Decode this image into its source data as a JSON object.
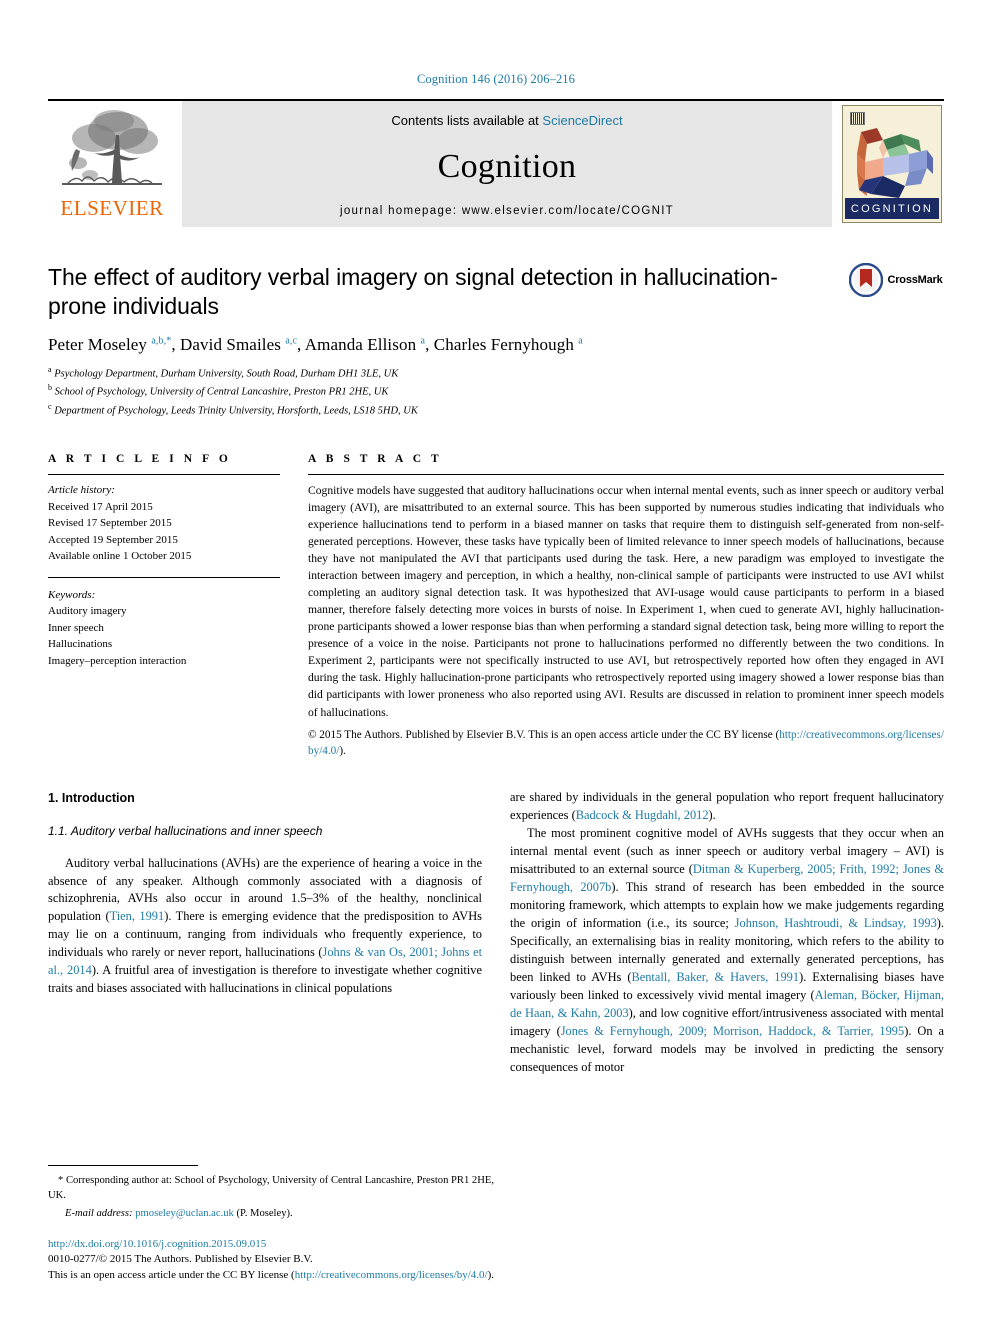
{
  "running_head": "Cognition 146 (2016) 206–216",
  "masthead": {
    "publisher_name": "ELSEVIER",
    "publisher_logo_icon": "elsevier-tree-icon",
    "contents_prefix": "Contents lists available at ",
    "contents_link": "ScienceDirect",
    "journal_name": "Cognition",
    "homepage_label": "journal homepage: www.elsevier.com/locate/COGNIT",
    "cover_title": "COGNITION",
    "cover_icon": "journal-cover-thumbnail"
  },
  "article": {
    "title": "The effect of auditory verbal imagery on signal detection in hallucination-prone individuals",
    "authors_html": "Peter Moseley <sup>a,b,</sup><sup>*</sup>, David Smailes <sup>a,c</sup>, Amanda Ellison <sup>a</sup>, Charles Fernyhough <sup>a</sup>",
    "affiliations": [
      {
        "marker": "a",
        "text": "Psychology Department, Durham University, South Road, Durham DH1 3LE, UK"
      },
      {
        "marker": "b",
        "text": "School of Psychology, University of Central Lancashire, Preston PR1 2HE, UK"
      },
      {
        "marker": "c",
        "text": "Department of Psychology, Leeds Trinity University, Horsforth, Leeds, LS18 5HD, UK"
      }
    ],
    "crossmark_label": "CrossMark",
    "crossmark_icon": "crossmark-badge-icon"
  },
  "article_info": {
    "heading": "A R T I C L E    I N F O",
    "history_label": "Article history:",
    "history": [
      "Received 17 April 2015",
      "Revised 17 September 2015",
      "Accepted 19 September 2015",
      "Available online 1 October 2015"
    ],
    "keywords_label": "Keywords:",
    "keywords": [
      "Auditory imagery",
      "Inner speech",
      "Hallucinations",
      "Imagery–perception interaction"
    ]
  },
  "abstract": {
    "heading": "A B S T R A C T",
    "text": "Cognitive models have suggested that auditory hallucinations occur when internal mental events, such as inner speech or auditory verbal imagery (AVI), are misattributed to an external source. This has been supported by numerous studies indicating that individuals who experience hallucinations tend to perform in a biased manner on tasks that require them to distinguish self-generated from non-self-generated perceptions. However, these tasks have typically been of limited relevance to inner speech models of hallucinations, because they have not manipulated the AVI that participants used during the task. Here, a new paradigm was employed to investigate the interaction between imagery and perception, in which a healthy, non-clinical sample of participants were instructed to use AVI whilst completing an auditory signal detection task. It was hypothesized that AVI-usage would cause participants to perform in a biased manner, therefore falsely detecting more voices in bursts of noise. In Experiment 1, when cued to generate AVI, highly hallucination-prone participants showed a lower response bias than when performing a standard signal detection task, being more willing to report the presence of a voice in the noise. Participants not prone to hallucinations performed no differently between the two conditions. In Experiment 2, participants were not specifically instructed to use AVI, but retrospectively reported how often they engaged in AVI during the task. Highly hallucination-prone participants who retrospectively reported using imagery showed a lower response bias than did participants with lower proneness who also reported using AVI. Results are discussed in relation to prominent inner speech models of hallucinations.",
    "copyright_prefix": "© 2015 The Authors. Published by Elsevier B.V. This is an open access article under the CC BY license (",
    "copyright_link_part1": "http://",
    "copyright_link_part2": "creativecommons.org/licenses/by/4.0/",
    "copyright_suffix": ")."
  },
  "body": {
    "section_number_title": "1. Introduction",
    "subsection_title": "1.1. Auditory verbal hallucinations and inner speech",
    "left_paragraphs": [
      {
        "segments": [
          {
            "t": "Auditory verbal hallucinations (AVHs) are the experience of hearing a voice in the absence of any speaker. Although commonly associated with a diagnosis of schizophrenia, AVHs also occur in around 1.5–3% of the healthy, nonclinical population (",
            "cite": false
          },
          {
            "t": "Tien, 1991",
            "cite": true
          },
          {
            "t": "). There is emerging evidence that the predisposition to AVHs may lie on a continuum, ranging from individuals who frequently experience, to individuals who rarely or never report, hallucinations (",
            "cite": false
          },
          {
            "t": "Johns & van Os, 2001; Johns et al., 2014",
            "cite": true
          },
          {
            "t": "). A fruitful area of investigation is therefore to investigate whether cognitive traits and biases associated with hallucinations in clinical populations",
            "cite": false
          }
        ]
      }
    ],
    "right_paragraphs": [
      {
        "indent": false,
        "segments": [
          {
            "t": "are shared by individuals in the general population who report frequent hallucinatory experiences (",
            "cite": false
          },
          {
            "t": "Badcock & Hugdahl, 2012",
            "cite": true
          },
          {
            "t": ").",
            "cite": false
          }
        ]
      },
      {
        "indent": true,
        "segments": [
          {
            "t": "The most prominent cognitive model of AVHs suggests that they occur when an internal mental event (such as inner speech or auditory verbal imagery – AVI) is misattributed to an external source (",
            "cite": false
          },
          {
            "t": "Ditman & Kuperberg, 2005; Frith, 1992; Jones & Fernyhough, 2007b",
            "cite": true
          },
          {
            "t": "). This strand of research has been embedded in the source monitoring framework, which attempts to explain how we make judgements regarding the origin of information (i.e., its source; ",
            "cite": false
          },
          {
            "t": "Johnson, Hashtroudi, & Lindsay, 1993",
            "cite": true
          },
          {
            "t": "). Specifically, an externalising bias in reality monitoring, which refers to the ability to distinguish between internally generated and externally generated perceptions, has been linked to AVHs (",
            "cite": false
          },
          {
            "t": "Bentall, Baker, & Havers, 1991",
            "cite": true
          },
          {
            "t": "). Externalising biases have variously been linked to excessively vivid mental imagery (",
            "cite": false
          },
          {
            "t": "Aleman, Böcker, Hijman, de Haan, & Kahn, 2003",
            "cite": true
          },
          {
            "t": "), and low cognitive effort/intrusiveness associated with mental imagery (",
            "cite": false
          },
          {
            "t": "Jones & Fernyhough, 2009; Morrison, Haddock, & Tarrier, 1995",
            "cite": true
          },
          {
            "t": "). On a mechanistic level, forward models may be involved in predicting the sensory consequences of motor",
            "cite": false
          }
        ]
      }
    ]
  },
  "footnotes": {
    "corresponding_marker": "*",
    "corresponding_text": "Corresponding author at: School of Psychology, University of Central Lancashire, Preston PR1 2HE, UK.",
    "email_label": "E-mail address:",
    "email_address": "pmoseley@uclan.ac.uk",
    "email_owner": "(P. Moseley).",
    "doi_url": "http://dx.doi.org/10.1016/j.cognition.2015.09.015",
    "issn_line": "0010-0277/© 2015 The Authors. Published by Elsevier B.V.",
    "license_prefix": "This is an open access article under the CC BY license (",
    "license_link": "http://creativecommons.org/licenses/by/4.0/",
    "license_suffix": ")."
  },
  "colors": {
    "link": "#1f7ba6",
    "elsevier_orange": "#ec6608",
    "banner_gray": "#e6e6e6"
  }
}
